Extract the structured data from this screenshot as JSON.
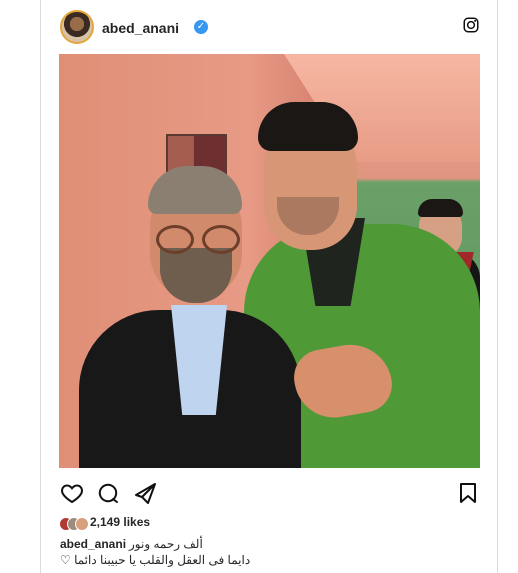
{
  "post": {
    "username": "abed_anani",
    "verified_icon": "verified-badge-icon",
    "likes": "2,149 likes",
    "caption_user": "abed_anani",
    "caption_line1": "ألف رحمه ونور",
    "caption_line2": "دايما فى العقل والقلب يا حبيبنا دائما ♡"
  },
  "icons": {
    "like": "heart-icon",
    "comment": "comment-icon",
    "share": "share-icon",
    "save": "bookmark-icon",
    "brand": "instagram-icon"
  },
  "colors": {
    "accent": "#3897f0",
    "avatar_ring": "#e4a63b",
    "text": "#262626"
  }
}
